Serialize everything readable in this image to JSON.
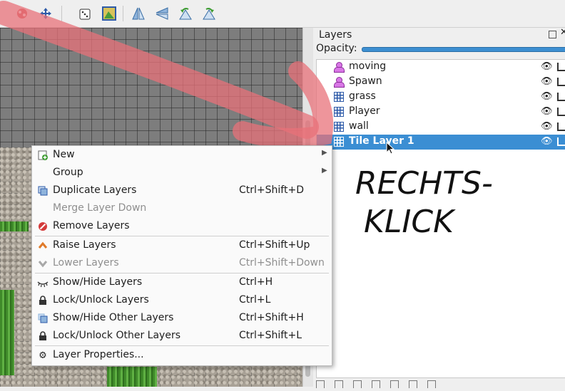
{
  "toolbar": {
    "buttons": [
      {
        "name": "random-mode-icon"
      },
      {
        "name": "move-icon"
      },
      {
        "name": "dice-icon"
      },
      {
        "name": "terrain-icon"
      },
      {
        "name": "flip-horizontal-icon"
      },
      {
        "name": "flip-vertical-icon"
      },
      {
        "name": "rotate-left-icon"
      },
      {
        "name": "rotate-right-icon"
      }
    ]
  },
  "layers_panel": {
    "title": "Layers",
    "opacity_label": "Opacity:",
    "opacity_value": 1.0,
    "layers": [
      {
        "name": "moving",
        "type": "object",
        "visible": true,
        "selected": false
      },
      {
        "name": "Spawn",
        "type": "object",
        "visible": true,
        "selected": false
      },
      {
        "name": "grass",
        "type": "tile",
        "visible": true,
        "selected": false
      },
      {
        "name": "Player",
        "type": "tile",
        "visible": true,
        "selected": false
      },
      {
        "name": "wall",
        "type": "tile",
        "visible": true,
        "selected": false
      },
      {
        "name": "Tile Layer 1",
        "type": "tile",
        "visible": true,
        "selected": true
      }
    ]
  },
  "context_menu": {
    "items": [
      {
        "label": "New",
        "shortcut": "",
        "icon": "new-layer-icon",
        "submenu": true,
        "enabled": true
      },
      {
        "label": "Group",
        "shortcut": "",
        "icon": "",
        "submenu": true,
        "enabled": true
      },
      {
        "label": "Duplicate Layers",
        "shortcut": "Ctrl+Shift+D",
        "icon": "duplicate-icon",
        "submenu": false,
        "enabled": true
      },
      {
        "label": "Merge Layer Down",
        "shortcut": "",
        "icon": "",
        "submenu": false,
        "enabled": false
      },
      {
        "label": "Remove Layers",
        "shortcut": "",
        "icon": "remove-icon",
        "submenu": false,
        "enabled": true
      },
      {
        "label": "Raise Layers",
        "shortcut": "Ctrl+Shift+Up",
        "icon": "raise-icon",
        "submenu": false,
        "enabled": true
      },
      {
        "label": "Lower Layers",
        "shortcut": "Ctrl+Shift+Down",
        "icon": "lower-icon",
        "submenu": false,
        "enabled": false
      },
      {
        "label": "Show/Hide Layers",
        "shortcut": "Ctrl+H",
        "icon": "hide-eye-icon",
        "submenu": false,
        "enabled": true
      },
      {
        "label": "Lock/Unlock Layers",
        "shortcut": "Ctrl+L",
        "icon": "lock-icon",
        "submenu": false,
        "enabled": true
      },
      {
        "label": "Show/Hide Other Layers",
        "shortcut": "Ctrl+Shift+H",
        "icon": "other-layers-icon",
        "submenu": false,
        "enabled": true
      },
      {
        "label": "Lock/Unlock Other Layers",
        "shortcut": "Ctrl+Shift+L",
        "icon": "lock-icon",
        "submenu": false,
        "enabled": true
      },
      {
        "label": "Layer Properties...",
        "shortcut": "",
        "icon": "gear-icon",
        "submenu": false,
        "enabled": true
      }
    ]
  },
  "annotation": {
    "text_line1": "RECHTS-",
    "text_line2": "KLICK",
    "color": "#e8717a"
  },
  "colors": {
    "selection": "#3b8ed3",
    "accent": "#3d8fd1"
  }
}
